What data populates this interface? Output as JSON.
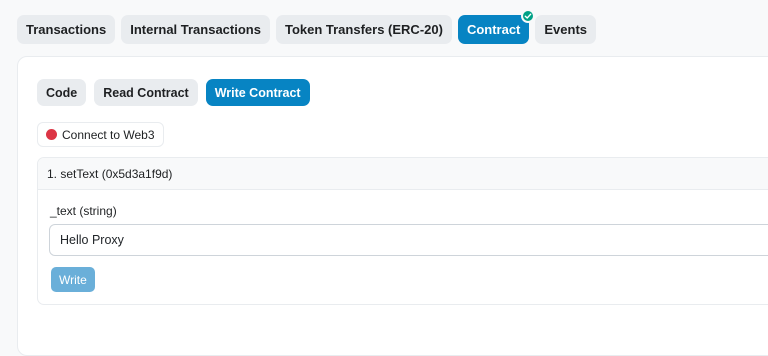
{
  "tabs": {
    "transactions": "Transactions",
    "internal_transactions": "Internal Transactions",
    "token_transfers": "Token Transfers (ERC-20)",
    "contract": "Contract",
    "events": "Events"
  },
  "contract_tabs": {
    "code": "Code",
    "read_contract": "Read Contract",
    "write_contract": "Write Contract"
  },
  "connect": {
    "label": "Connect to Web3",
    "status_color": "#dc3545"
  },
  "write_function": {
    "header": "1. setText (0x5d3a1f9d)",
    "param_label": "_text (string)",
    "param_value": "Hello Proxy",
    "button_label": "Write"
  },
  "colors": {
    "accent": "#0784c3",
    "verified": "#00a186"
  }
}
